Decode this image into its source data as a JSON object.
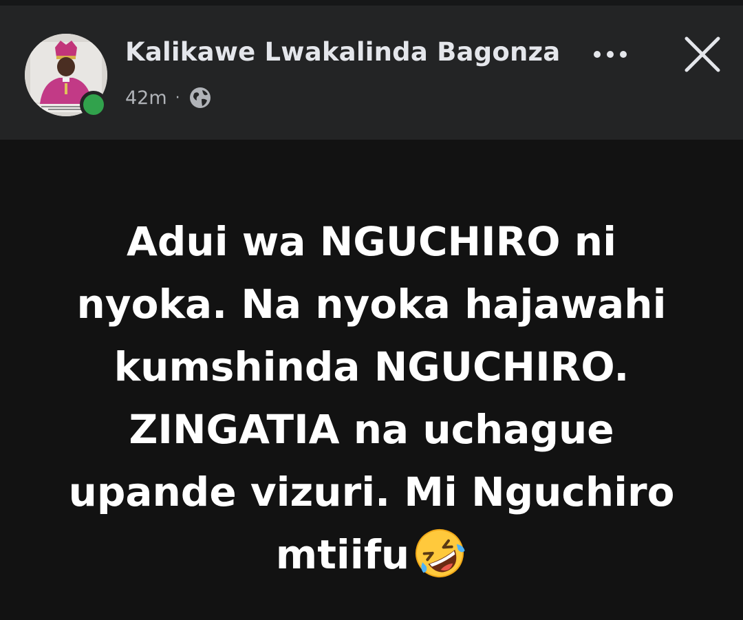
{
  "post": {
    "author_name": "Kalikawe Lwakalinda Bagonza",
    "time_ago": "42m",
    "separator": "·",
    "audience_icon": "globe-icon",
    "author_online": true,
    "actions": {
      "more_icon": "more-horizontal-icon",
      "close_icon": "close-icon"
    },
    "text_lines": [
      "Adui  wa NGUCHIRO ni",
      "nyoka. Na nyoka hajawahi",
      "kumshinda NGUCHIRO.",
      "ZINGATIA na uchague",
      "upande vizuri. Mi Nguchiro",
      "mtiifu"
    ],
    "trailing_emoji": "rolling-on-floor-laughing-emoji"
  },
  "colors": {
    "header_bg": "#232425",
    "body_bg": "#121212",
    "online": "#31a24c",
    "text_primary": "#e4e6eb",
    "text_secondary": "#b0b3b8"
  }
}
